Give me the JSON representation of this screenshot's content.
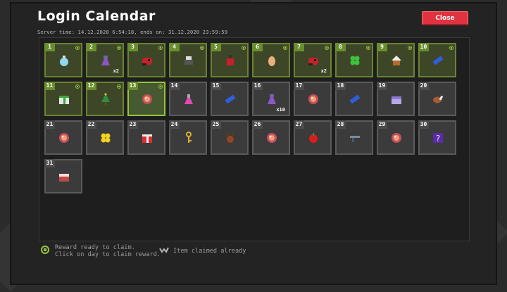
{
  "window": {
    "title": "Login Calendar",
    "server_time": "Server time: 14.12.2020 6:54:18, ends on: 31.12.2020 23:59:59",
    "close_label": "Close"
  },
  "days": [
    {
      "day": "1",
      "state": "claimed",
      "item": "potion-blue-icon",
      "qty": ""
    },
    {
      "day": "2",
      "state": "claimed",
      "item": "potion-purple-icon",
      "qty": "x2"
    },
    {
      "day": "3",
      "state": "claimed",
      "item": "red-creature-icon",
      "qty": ""
    },
    {
      "day": "4",
      "state": "claimed",
      "item": "pot-icon",
      "qty": ""
    },
    {
      "day": "5",
      "state": "claimed",
      "item": "red-jar-icon",
      "qty": ""
    },
    {
      "day": "6",
      "state": "claimed",
      "item": "egg-icon",
      "qty": ""
    },
    {
      "day": "7",
      "state": "claimed",
      "item": "red-creature-icon",
      "qty": "x2"
    },
    {
      "day": "8",
      "state": "claimed",
      "item": "clover-icon",
      "qty": ""
    },
    {
      "day": "9",
      "state": "claimed",
      "item": "gingerbread-house-icon",
      "qty": ""
    },
    {
      "day": "10",
      "state": "claimed",
      "item": "blue-ticket-icon",
      "qty": ""
    },
    {
      "day": "11",
      "state": "claimed",
      "item": "gift-green-icon",
      "qty": ""
    },
    {
      "day": "12",
      "state": "claimed",
      "item": "xmas-tree-icon",
      "qty": ""
    },
    {
      "day": "13",
      "state": "ready",
      "item": "orb-icon",
      "qty": ""
    },
    {
      "day": "14",
      "state": "locked",
      "item": "pink-potion-icon",
      "qty": ""
    },
    {
      "day": "15",
      "state": "locked",
      "item": "blue-ticket-icon",
      "qty": ""
    },
    {
      "day": "16",
      "state": "locked",
      "item": "potion-purple-icon",
      "qty": "x10"
    },
    {
      "day": "17",
      "state": "locked",
      "item": "orb-icon",
      "qty": ""
    },
    {
      "day": "18",
      "state": "locked",
      "item": "blue-ticket-icon",
      "qty": ""
    },
    {
      "day": "19",
      "state": "locked",
      "item": "chest-icon",
      "qty": ""
    },
    {
      "day": "20",
      "state": "locked",
      "item": "meat-icon",
      "qty": ""
    },
    {
      "day": "21",
      "state": "locked",
      "item": "orb-icon",
      "qty": ""
    },
    {
      "day": "22",
      "state": "locked",
      "item": "yellow-clover-icon",
      "qty": ""
    },
    {
      "day": "23",
      "state": "locked",
      "item": "red-gift-icon",
      "qty": ""
    },
    {
      "day": "24",
      "state": "locked",
      "item": "key-icon",
      "qty": ""
    },
    {
      "day": "25",
      "state": "locked",
      "item": "reindeer-icon",
      "qty": ""
    },
    {
      "day": "26",
      "state": "locked",
      "item": "orb-icon",
      "qty": ""
    },
    {
      "day": "27",
      "state": "locked",
      "item": "apple-icon",
      "qty": ""
    },
    {
      "day": "28",
      "state": "locked",
      "item": "gun-icon",
      "qty": ""
    },
    {
      "day": "29",
      "state": "locked",
      "item": "orb-icon",
      "qty": ""
    },
    {
      "day": "30",
      "state": "locked",
      "item": "mystery-box-icon",
      "qty": ""
    },
    {
      "day": "31",
      "state": "locked",
      "item": "red-chest-icon",
      "qty": ""
    }
  ],
  "legend": {
    "ready_line1": "Reward ready to claim.",
    "ready_line2": "Click on day to claim reward.",
    "claimed": "Item claimed already"
  },
  "colors": {
    "accent_green": "#93c53c",
    "close_red": "#e0333f",
    "panel": "#1e1e1e"
  }
}
